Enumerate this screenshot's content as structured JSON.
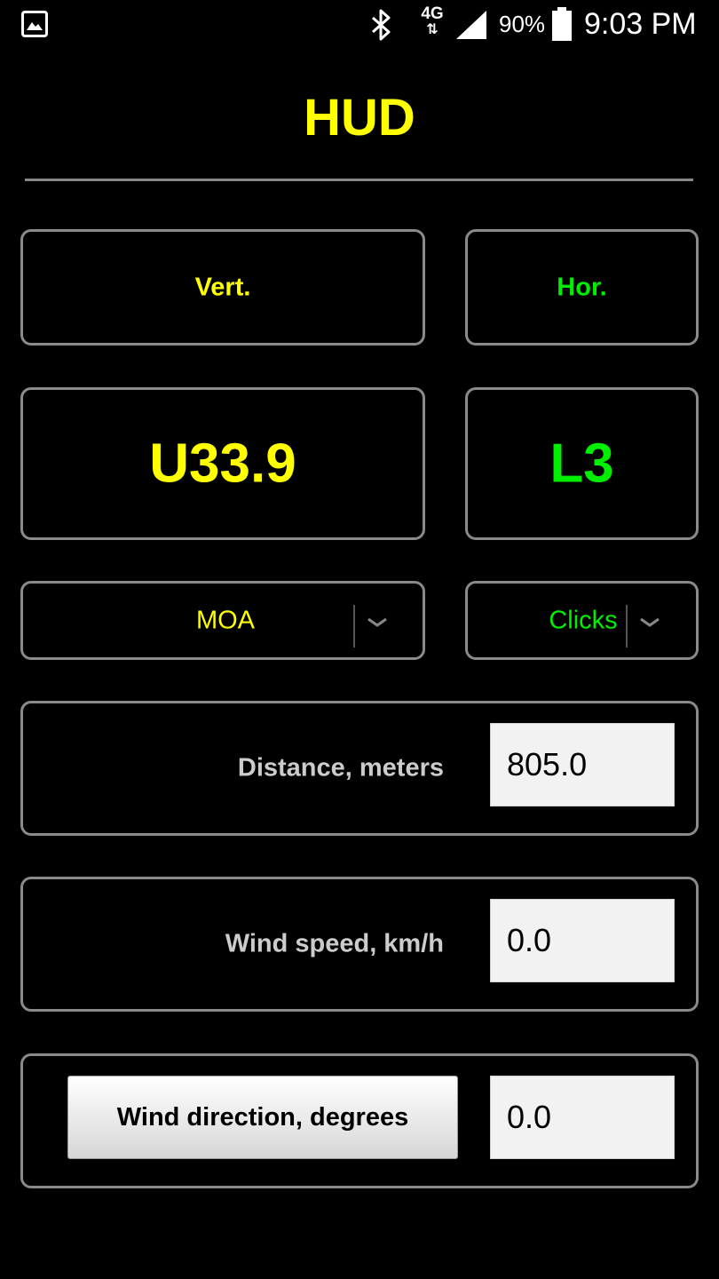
{
  "status_bar": {
    "network": "4G",
    "battery_percent": "90%",
    "time": "9:03 PM"
  },
  "header": {
    "title": "HUD"
  },
  "correction": {
    "vertical_label": "Vert.",
    "horizontal_label": "Hor.",
    "vertical_value": "U33.9",
    "horizontal_value": "L3"
  },
  "units": {
    "vertical_selected": "MOA",
    "horizontal_selected": "Clicks"
  },
  "inputs": {
    "distance_label": "Distance, meters",
    "distance_value": "805.0",
    "wind_speed_label": "Wind speed, km/h",
    "wind_speed_value": "0.0",
    "wind_direction_button": "Wind direction, degrees",
    "wind_direction_value": "0.0"
  },
  "colors": {
    "vertical_accent": "#ffff00",
    "horizontal_accent": "#00ee00",
    "background": "#000000"
  },
  "icons": {
    "gallery": "gallery-icon",
    "bluetooth": "bluetooth-icon",
    "signal": "signal-icon",
    "battery": "battery-icon",
    "chevron": "chevron-down-icon"
  }
}
